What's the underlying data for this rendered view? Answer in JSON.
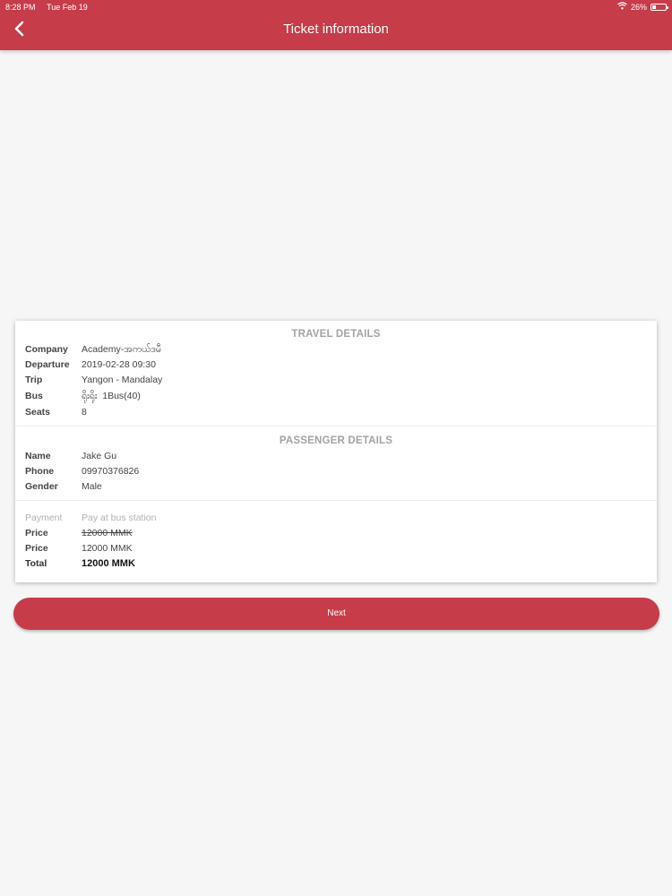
{
  "status_bar": {
    "time": "8:28 PM",
    "date": "Tue Feb 19",
    "battery": "26%",
    "battery_level": 0.26
  },
  "header": {
    "title": "Ticket information"
  },
  "travel": {
    "title": "TRAVEL DETAILS",
    "rows": [
      {
        "key": "Company",
        "value": "Academy-အကယ်ဒမီ"
      },
      {
        "key": "Departure",
        "value": "2019-02-28 09:30"
      },
      {
        "key": "Trip",
        "value": "Yangon - Mandalay"
      },
      {
        "key": "Bus",
        "value": "ရိုးရိုး  1Bus(40)"
      },
      {
        "key": "Seats",
        "value": "8"
      }
    ]
  },
  "passenger": {
    "title": "PASSENGER DETAILS",
    "rows": [
      {
        "key": "Name",
        "value": "Jake Gu"
      },
      {
        "key": "Phone",
        "value": "09970376826"
      },
      {
        "key": "Gender",
        "value": "Male"
      }
    ]
  },
  "payment": {
    "payment_key": "Payment",
    "payment_value": "Pay at bus station",
    "price_key": "Price",
    "original_price": "12000 MMK",
    "price_key_2": "Price",
    "price": "12000 MMK",
    "total_key": "Total",
    "total": "12000 MMK"
  },
  "actions": {
    "next_label": "Next"
  },
  "colors": {
    "brand": "#c63c49"
  }
}
